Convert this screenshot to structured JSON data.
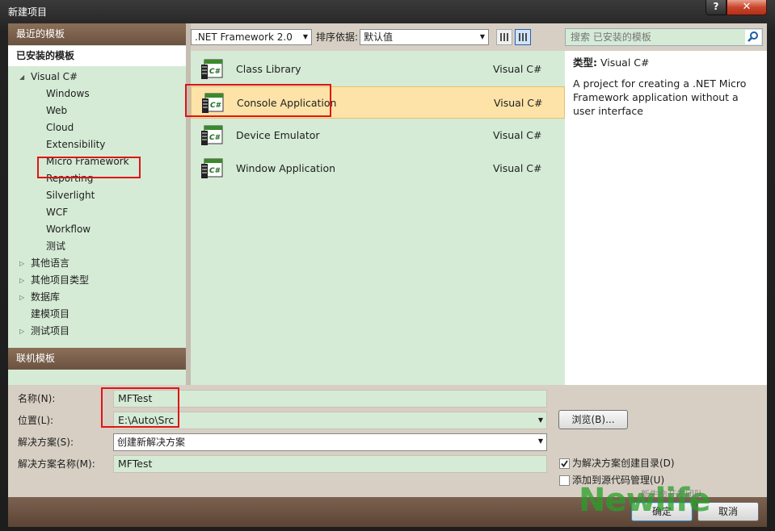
{
  "window": {
    "title": "新建项目",
    "help_label": "?",
    "close_label": "✕"
  },
  "left_panel": {
    "recent_header": "最近的模板",
    "installed_header": "已安装的模板",
    "online_header": "联机模板",
    "tree": [
      {
        "label": "Visual C#",
        "level": 0,
        "arrow": "◢"
      },
      {
        "label": "Windows",
        "level": 1
      },
      {
        "label": "Web",
        "level": 1
      },
      {
        "label": "Cloud",
        "level": 1
      },
      {
        "label": "Extensibility",
        "level": 1
      },
      {
        "label": "Micro Framework",
        "level": 1
      },
      {
        "label": "Reporting",
        "level": 1
      },
      {
        "label": "Silverlight",
        "level": 1
      },
      {
        "label": "WCF",
        "level": 1
      },
      {
        "label": "Workflow",
        "level": 1
      },
      {
        "label": "测试",
        "level": 1
      },
      {
        "label": "其他语言",
        "level": 0,
        "arrow": "▷"
      },
      {
        "label": "其他项目类型",
        "level": 0,
        "arrow": "▷"
      },
      {
        "label": "数据库",
        "level": 0,
        "arrow": "▷"
      },
      {
        "label": "建模项目",
        "level": 0
      },
      {
        "label": "测试项目",
        "level": 0,
        "arrow": "▷"
      }
    ]
  },
  "toolbar": {
    "framework_value": ".NET Framework 2.0",
    "sort_label": "排序依据:",
    "sort_value": "默认值"
  },
  "templates": [
    {
      "name": "Class Library",
      "lang": "Visual C#",
      "selected": false
    },
    {
      "name": "Console Application",
      "lang": "Visual C#",
      "selected": true
    },
    {
      "name": "Device Emulator",
      "lang": "Visual C#",
      "selected": false
    },
    {
      "name": "Window Application",
      "lang": "Visual C#",
      "selected": false
    }
  ],
  "icon_badge": "C#",
  "search": {
    "placeholder": "搜索 已安装的模板"
  },
  "description": {
    "type_label": "类型:",
    "type_value": "Visual C#",
    "text": "A project for creating a .NET Micro Framework application without a user interface"
  },
  "form": {
    "name_label": "名称(N):",
    "name_value": "MFTest",
    "location_label": "位置(L):",
    "location_value": "E:\\Auto\\Src",
    "solution_label": "解决方案(S):",
    "solution_value": "创建新解决方案",
    "solution_name_label": "解决方案名称(M):",
    "solution_name_value": "MFTest",
    "browse_label": "浏览(B)...",
    "create_dir_label": "为解决方案创建目录(D)",
    "create_dir_checked": true,
    "source_control_label": "添加到源代码管理(U)",
    "source_control_checked": false
  },
  "buttons": {
    "ok": "确定",
    "cancel": "取消"
  },
  "watermark": {
    "text": "Newlife",
    "sub": "新生命开发团队"
  }
}
